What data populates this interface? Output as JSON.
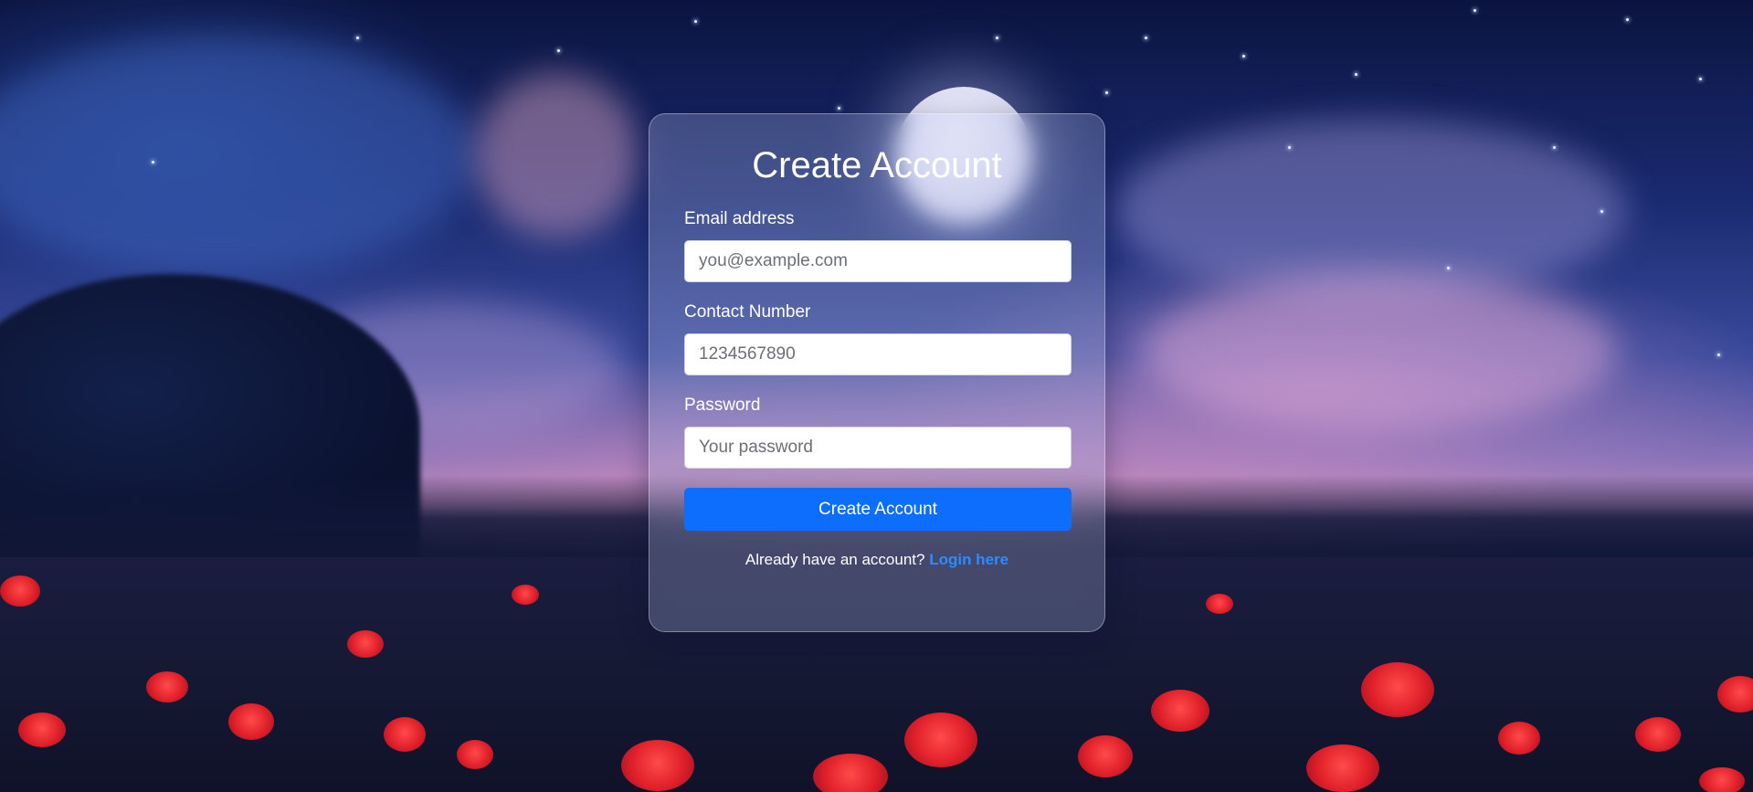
{
  "form": {
    "title": "Create Account",
    "email": {
      "label": "Email address",
      "placeholder": "you@example.com",
      "value": ""
    },
    "contact": {
      "label": "Contact Number",
      "placeholder": "1234567890",
      "value": ""
    },
    "password": {
      "label": "Password",
      "placeholder": "Your password",
      "value": ""
    },
    "submit_label": "Create Account",
    "footer": {
      "prompt": "Already have an account?",
      "link_label": "Login here"
    }
  },
  "colors": {
    "primary_button": "#0d6efd",
    "link": "#2e8bff"
  }
}
